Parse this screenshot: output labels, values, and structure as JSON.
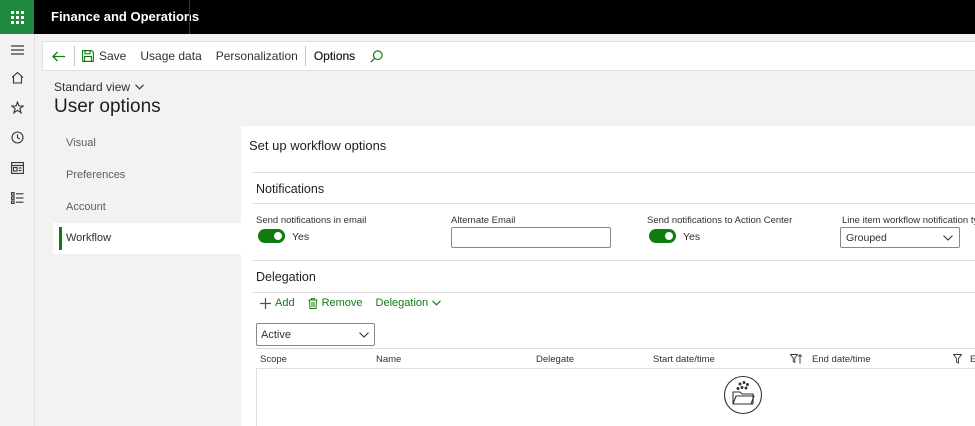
{
  "app": {
    "title": "Finance and Operations"
  },
  "actions": {
    "save": "Save",
    "usage_data": "Usage data",
    "personalization": "Personalization",
    "options": "Options"
  },
  "page": {
    "view": "Standard view",
    "title": "User options",
    "section_title": "Set up workflow options"
  },
  "nav": {
    "tabs": [
      "Visual",
      "Preferences",
      "Account",
      "Workflow"
    ],
    "active": "Workflow"
  },
  "notifications": {
    "title": "Notifications",
    "email_label": "Send notifications in email",
    "email_value": "Yes",
    "alternate_email_label": "Alternate Email",
    "alternate_email_value": "",
    "action_center_label": "Send notifications to Action Center",
    "action_center_value": "Yes",
    "line_item_label": "Line item workflow notification ty",
    "line_item_value": "Grouped"
  },
  "delegation": {
    "title": "Delegation",
    "add": "Add",
    "remove": "Remove",
    "menu": "Delegation",
    "filter": "Active",
    "columns": [
      "Scope",
      "Name",
      "Delegate",
      "Start date/time",
      "End date/time",
      "E"
    ]
  },
  "colors": {
    "accent": "#107c10",
    "topbar": "#000000",
    "waffle": "#1e8a3e"
  }
}
